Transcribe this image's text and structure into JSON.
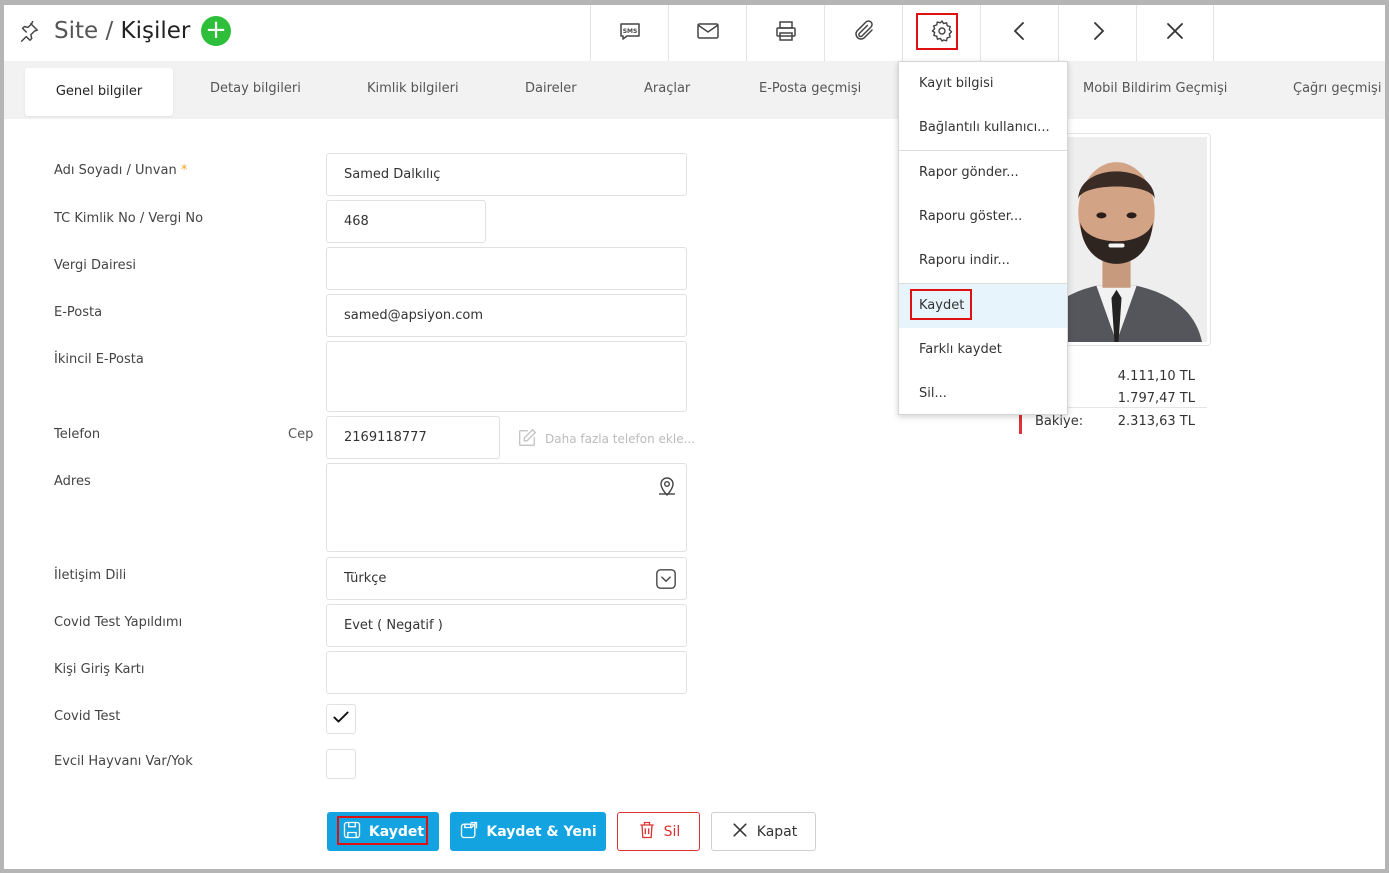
{
  "header": {
    "title_prefix": "Site / ",
    "title_main": "Kişiler",
    "add_label": "+",
    "toolbar": [
      "sms-icon",
      "mail-icon",
      "print-icon",
      "attachment-icon",
      "gear-icon",
      "chevron-left-icon",
      "chevron-right-icon",
      "close-icon"
    ]
  },
  "tabs": [
    {
      "label": "Genel bilgiler",
      "active": true
    },
    {
      "label": "Detay bilgileri"
    },
    {
      "label": "Kimlik bilgileri"
    },
    {
      "label": "Daireler"
    },
    {
      "label": "Araçlar"
    },
    {
      "label": "E-Posta geçmişi"
    },
    {
      "label": "Mobil Bildirim Geçmişi"
    },
    {
      "label": "Çağrı geçmişi"
    }
  ],
  "form": {
    "name_label": "Adı Soyadı / Unvan",
    "name_required": "*",
    "name_value": "Samed Dalkılıç",
    "tc_label": "TC Kimlik No / Vergi No",
    "tc_value": "468",
    "tax_office_label": "Vergi Dairesi",
    "tax_office_value": "",
    "email_label": "E-Posta",
    "email_value": "samed@apsiyon.com",
    "secondary_email_label": "İkincil E-Posta",
    "secondary_email_value": "",
    "phone_label": "Telefon",
    "phone_type": "Cep",
    "phone_value": "2169118777",
    "more_phone": "Daha fazla telefon ekle...",
    "address_label": "Adres",
    "address_value": "",
    "language_label": "İletişim Dili",
    "language_value": "Türkçe",
    "covid_made_label": "Covid Test Yapıldımı",
    "covid_made_value": "Evet ( Negatif )",
    "entry_card_label": "Kişi Giriş Kartı",
    "entry_card_value": "",
    "covid_test_label": "Covid Test",
    "covid_test_checked": true,
    "pet_label": "Evcil Hayvanı Var/Yok",
    "pet_checked": false
  },
  "buttons": {
    "save": "Kaydet",
    "save_new": "Kaydet & Yeni",
    "delete": "Sil",
    "close": "Kapat"
  },
  "balance": {
    "rows": [
      {
        "label": "ç:",
        "value": "4.111,10 TL"
      },
      {
        "label": "k:",
        "value": "1.797,47 TL"
      },
      {
        "label": "Bakiye:",
        "value": "2.313,63 TL"
      }
    ]
  },
  "dropdown": {
    "items": [
      {
        "label": "Kayıt bilgisi"
      },
      {
        "label": "Bağlantılı kullanıcı..."
      },
      {
        "label": "Rapor gönder..."
      },
      {
        "label": "Raporu göster..."
      },
      {
        "label": "Raporu indir..."
      },
      {
        "label": "Kaydet",
        "active": true
      },
      {
        "label": "Farklı kaydet"
      },
      {
        "label": "Sil..."
      }
    ]
  },
  "colors": {
    "primary": "#12a3e0",
    "add": "#2dbf3a",
    "danger": "#dd3333",
    "highlight": "#dd1111",
    "tab_bar": "#f2f2f2"
  }
}
